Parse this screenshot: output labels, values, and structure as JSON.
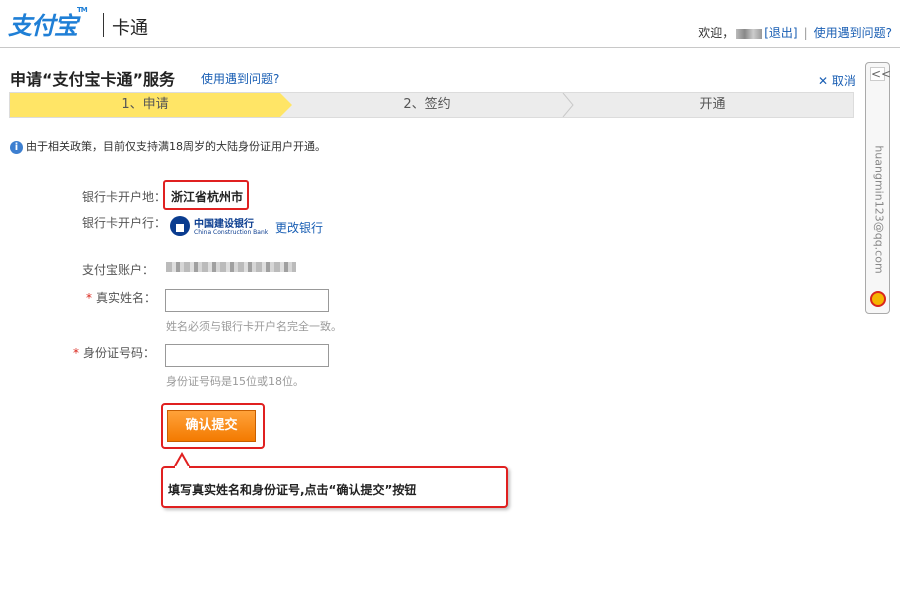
{
  "header": {
    "logo": "支付宝",
    "logo_tm": "TM",
    "product": "卡通",
    "welcome": "欢迎，",
    "logout": "[退出]",
    "separator": "|",
    "help": "使用遇到问题?"
  },
  "page": {
    "title": "申请“支付宝卡通”服务",
    "help_link": "使用遇到问题?",
    "cancel": "✕ 取消"
  },
  "steps": [
    "1、申请",
    "2、签约",
    "开通"
  ],
  "notice": {
    "icon": "info-icon",
    "text": "由于相关政策，目前仅支持满18周岁的大陆身份证用户开通。"
  },
  "form": {
    "location_label": "银行卡开户地：",
    "location_value": "浙江省杭州市",
    "bank_label": "银行卡开户行：",
    "bank_name_cn": "中国建设银行",
    "bank_name_en": "China Construction Bank",
    "change_bank": "更改银行",
    "account_label": "支付宝账户：",
    "required_mark": "*",
    "name_label": "真实姓名：",
    "name_value": "",
    "name_hint": "姓名必须与银行卡开户名完全一致。",
    "id_label": "身份证号码：",
    "id_value": "",
    "id_hint": "身份证号码是15位或18位。",
    "submit": "确认提交"
  },
  "callout": {
    "text": "填写真实姓名和身份证号,点击“确认提交”按钮"
  },
  "side_widget": {
    "collapse": "<<",
    "email": "huangmin123@qq.com"
  }
}
